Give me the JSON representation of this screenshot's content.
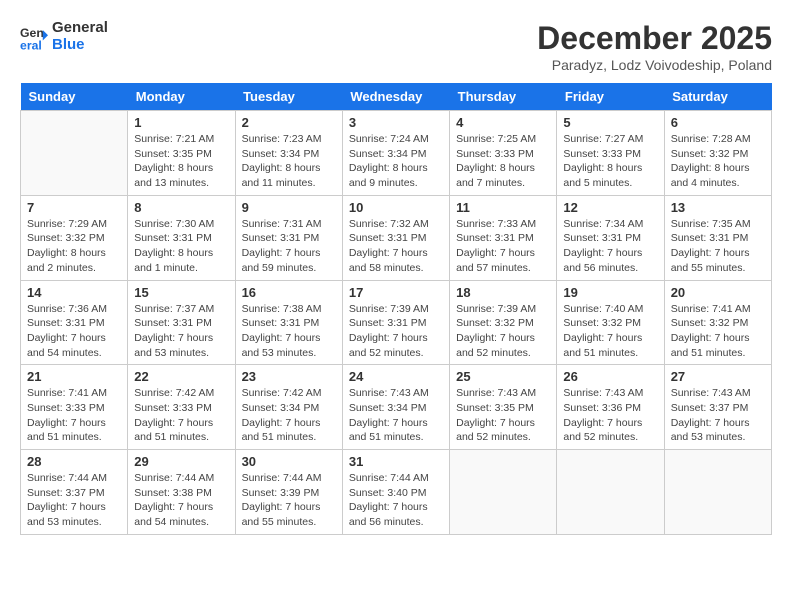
{
  "header": {
    "logo_line1": "General",
    "logo_line2": "Blue",
    "month": "December 2025",
    "location": "Paradyz, Lodz Voivodeship, Poland"
  },
  "weekdays": [
    "Sunday",
    "Monday",
    "Tuesday",
    "Wednesday",
    "Thursday",
    "Friday",
    "Saturday"
  ],
  "weeks": [
    [
      {
        "day": "",
        "sunrise": "",
        "sunset": "",
        "daylight": ""
      },
      {
        "day": "1",
        "sunrise": "Sunrise: 7:21 AM",
        "sunset": "Sunset: 3:35 PM",
        "daylight": "Daylight: 8 hours and 13 minutes."
      },
      {
        "day": "2",
        "sunrise": "Sunrise: 7:23 AM",
        "sunset": "Sunset: 3:34 PM",
        "daylight": "Daylight: 8 hours and 11 minutes."
      },
      {
        "day": "3",
        "sunrise": "Sunrise: 7:24 AM",
        "sunset": "Sunset: 3:34 PM",
        "daylight": "Daylight: 8 hours and 9 minutes."
      },
      {
        "day": "4",
        "sunrise": "Sunrise: 7:25 AM",
        "sunset": "Sunset: 3:33 PM",
        "daylight": "Daylight: 8 hours and 7 minutes."
      },
      {
        "day": "5",
        "sunrise": "Sunrise: 7:27 AM",
        "sunset": "Sunset: 3:33 PM",
        "daylight": "Daylight: 8 hours and 5 minutes."
      },
      {
        "day": "6",
        "sunrise": "Sunrise: 7:28 AM",
        "sunset": "Sunset: 3:32 PM",
        "daylight": "Daylight: 8 hours and 4 minutes."
      }
    ],
    [
      {
        "day": "7",
        "sunrise": "Sunrise: 7:29 AM",
        "sunset": "Sunset: 3:32 PM",
        "daylight": "Daylight: 8 hours and 2 minutes."
      },
      {
        "day": "8",
        "sunrise": "Sunrise: 7:30 AM",
        "sunset": "Sunset: 3:31 PM",
        "daylight": "Daylight: 8 hours and 1 minute."
      },
      {
        "day": "9",
        "sunrise": "Sunrise: 7:31 AM",
        "sunset": "Sunset: 3:31 PM",
        "daylight": "Daylight: 7 hours and 59 minutes."
      },
      {
        "day": "10",
        "sunrise": "Sunrise: 7:32 AM",
        "sunset": "Sunset: 3:31 PM",
        "daylight": "Daylight: 7 hours and 58 minutes."
      },
      {
        "day": "11",
        "sunrise": "Sunrise: 7:33 AM",
        "sunset": "Sunset: 3:31 PM",
        "daylight": "Daylight: 7 hours and 57 minutes."
      },
      {
        "day": "12",
        "sunrise": "Sunrise: 7:34 AM",
        "sunset": "Sunset: 3:31 PM",
        "daylight": "Daylight: 7 hours and 56 minutes."
      },
      {
        "day": "13",
        "sunrise": "Sunrise: 7:35 AM",
        "sunset": "Sunset: 3:31 PM",
        "daylight": "Daylight: 7 hours and 55 minutes."
      }
    ],
    [
      {
        "day": "14",
        "sunrise": "Sunrise: 7:36 AM",
        "sunset": "Sunset: 3:31 PM",
        "daylight": "Daylight: 7 hours and 54 minutes."
      },
      {
        "day": "15",
        "sunrise": "Sunrise: 7:37 AM",
        "sunset": "Sunset: 3:31 PM",
        "daylight": "Daylight: 7 hours and 53 minutes."
      },
      {
        "day": "16",
        "sunrise": "Sunrise: 7:38 AM",
        "sunset": "Sunset: 3:31 PM",
        "daylight": "Daylight: 7 hours and 53 minutes."
      },
      {
        "day": "17",
        "sunrise": "Sunrise: 7:39 AM",
        "sunset": "Sunset: 3:31 PM",
        "daylight": "Daylight: 7 hours and 52 minutes."
      },
      {
        "day": "18",
        "sunrise": "Sunrise: 7:39 AM",
        "sunset": "Sunset: 3:32 PM",
        "daylight": "Daylight: 7 hours and 52 minutes."
      },
      {
        "day": "19",
        "sunrise": "Sunrise: 7:40 AM",
        "sunset": "Sunset: 3:32 PM",
        "daylight": "Daylight: 7 hours and 51 minutes."
      },
      {
        "day": "20",
        "sunrise": "Sunrise: 7:41 AM",
        "sunset": "Sunset: 3:32 PM",
        "daylight": "Daylight: 7 hours and 51 minutes."
      }
    ],
    [
      {
        "day": "21",
        "sunrise": "Sunrise: 7:41 AM",
        "sunset": "Sunset: 3:33 PM",
        "daylight": "Daylight: 7 hours and 51 minutes."
      },
      {
        "day": "22",
        "sunrise": "Sunrise: 7:42 AM",
        "sunset": "Sunset: 3:33 PM",
        "daylight": "Daylight: 7 hours and 51 minutes."
      },
      {
        "day": "23",
        "sunrise": "Sunrise: 7:42 AM",
        "sunset": "Sunset: 3:34 PM",
        "daylight": "Daylight: 7 hours and 51 minutes."
      },
      {
        "day": "24",
        "sunrise": "Sunrise: 7:43 AM",
        "sunset": "Sunset: 3:34 PM",
        "daylight": "Daylight: 7 hours and 51 minutes."
      },
      {
        "day": "25",
        "sunrise": "Sunrise: 7:43 AM",
        "sunset": "Sunset: 3:35 PM",
        "daylight": "Daylight: 7 hours and 52 minutes."
      },
      {
        "day": "26",
        "sunrise": "Sunrise: 7:43 AM",
        "sunset": "Sunset: 3:36 PM",
        "daylight": "Daylight: 7 hours and 52 minutes."
      },
      {
        "day": "27",
        "sunrise": "Sunrise: 7:43 AM",
        "sunset": "Sunset: 3:37 PM",
        "daylight": "Daylight: 7 hours and 53 minutes."
      }
    ],
    [
      {
        "day": "28",
        "sunrise": "Sunrise: 7:44 AM",
        "sunset": "Sunset: 3:37 PM",
        "daylight": "Daylight: 7 hours and 53 minutes."
      },
      {
        "day": "29",
        "sunrise": "Sunrise: 7:44 AM",
        "sunset": "Sunset: 3:38 PM",
        "daylight": "Daylight: 7 hours and 54 minutes."
      },
      {
        "day": "30",
        "sunrise": "Sunrise: 7:44 AM",
        "sunset": "Sunset: 3:39 PM",
        "daylight": "Daylight: 7 hours and 55 minutes."
      },
      {
        "day": "31",
        "sunrise": "Sunrise: 7:44 AM",
        "sunset": "Sunset: 3:40 PM",
        "daylight": "Daylight: 7 hours and 56 minutes."
      },
      {
        "day": "",
        "sunrise": "",
        "sunset": "",
        "daylight": ""
      },
      {
        "day": "",
        "sunrise": "",
        "sunset": "",
        "daylight": ""
      },
      {
        "day": "",
        "sunrise": "",
        "sunset": "",
        "daylight": ""
      }
    ]
  ]
}
